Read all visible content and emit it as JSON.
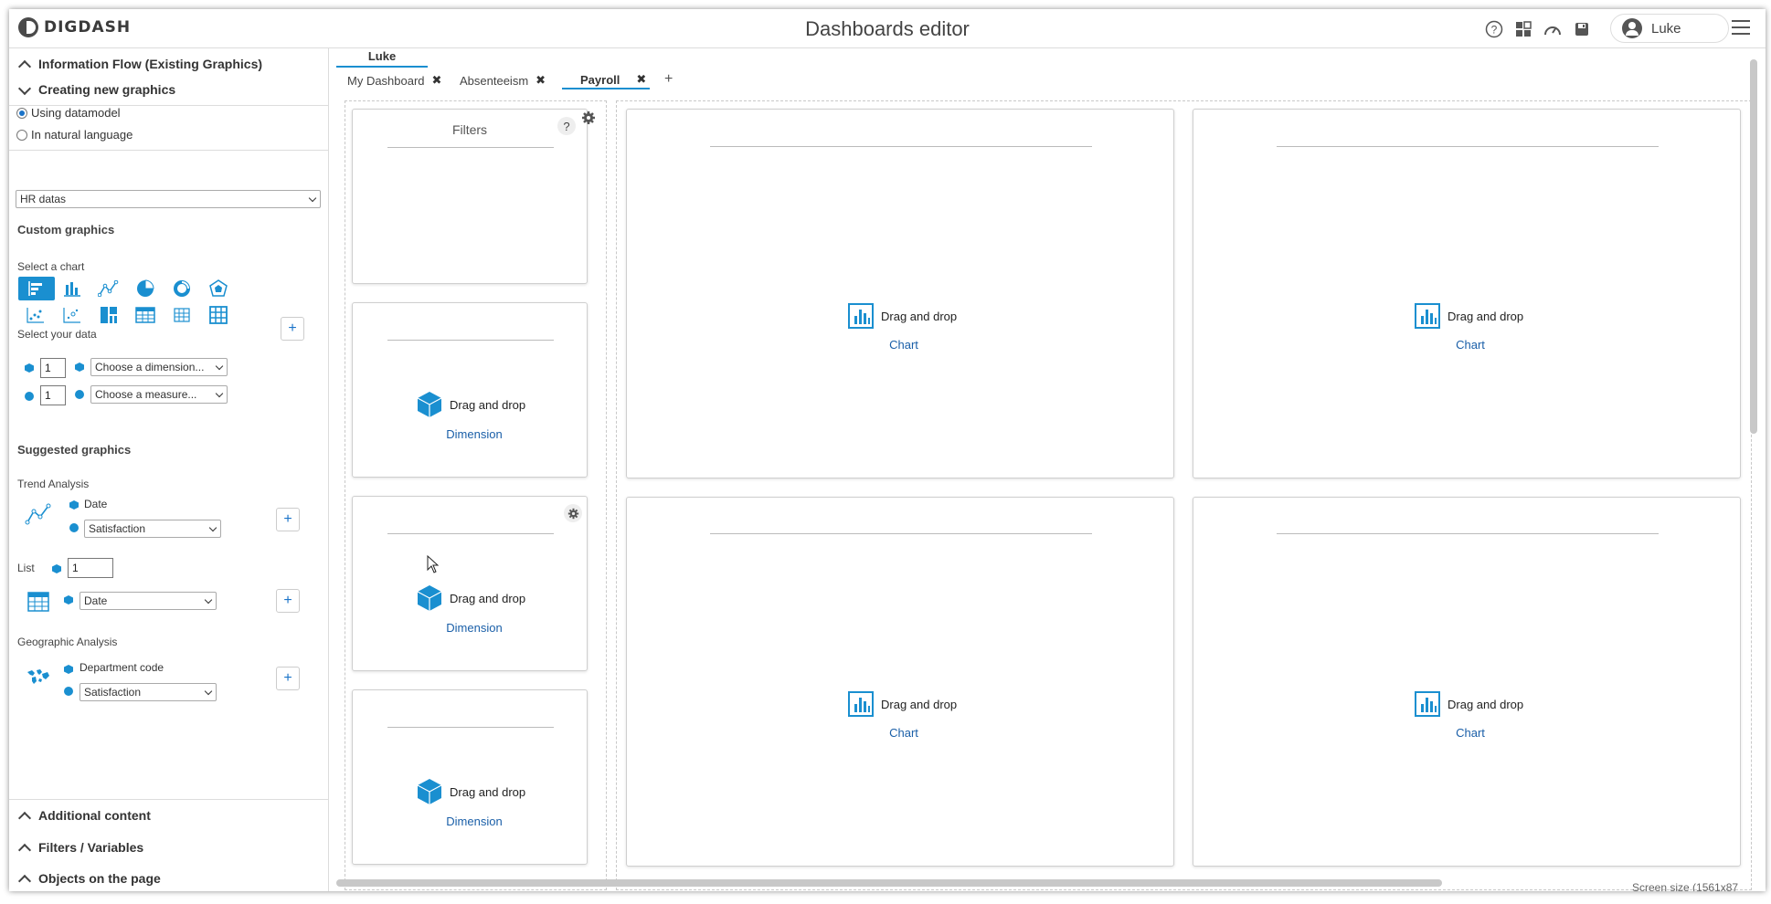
{
  "header": {
    "logo_text": "DIGDASH",
    "title": "Dashboards editor",
    "user_name": "Luke",
    "icons": [
      "help-icon",
      "widgets-icon",
      "gauge-icon",
      "save-icon",
      "user-icon",
      "hamburger-menu-icon"
    ]
  },
  "sidebar": {
    "info_flow": "Information Flow (Existing Graphics)",
    "creating_new": "Creating new graphics",
    "radio_datamodel": "Using datamodel",
    "radio_natural": "In natural language",
    "datamodel_value": "HR datas",
    "custom_graphics": "Custom graphics",
    "select_chart": "Select a chart",
    "chart_types": [
      "bar-horizontal",
      "bar-vertical",
      "line",
      "pie",
      "donut",
      "radar",
      "scatter",
      "bubble",
      "treemap",
      "table",
      "grid",
      "crosstab"
    ],
    "select_data": "Select your data",
    "dimension_count": "1",
    "dimension_placeholder": "Choose a dimension...",
    "measure_count": "1",
    "measure_placeholder": "Choose a measure...",
    "suggested_graphics": "Suggested graphics",
    "trend": {
      "label": "Trend Analysis",
      "dimension": "Date",
      "measure": "Satisfaction"
    },
    "list": {
      "label": "List",
      "count": "1",
      "dimension": "Date"
    },
    "geo": {
      "label": "Geographic Analysis",
      "dimension": "Department code",
      "measure": "Satisfaction"
    },
    "additional_content": "Additional content",
    "filters_variables": "Filters / Variables",
    "objects_on_page": "Objects on the page",
    "plus": "+"
  },
  "tabs": {
    "user": "Luke",
    "items": [
      "My Dashboard",
      "Absenteeism",
      "Payroll"
    ],
    "close": "✖",
    "add": "+"
  },
  "canvas": {
    "filters_title": "Filters",
    "drag_drop": "Drag and drop",
    "dimension_link": "Dimension",
    "chart_link": "Chart",
    "help": "?",
    "screen_size": "Screen size (1561x87"
  },
  "colors": {
    "accent": "#1a8fd0",
    "link": "#1a5fa8"
  }
}
